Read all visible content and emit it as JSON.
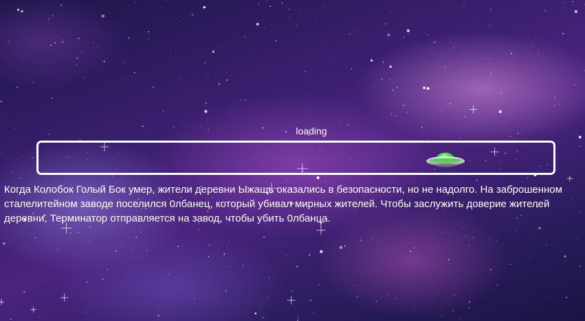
{
  "loading": {
    "label": "loading",
    "progress": 0.79
  },
  "story": {
    "text": "Когда Колобок Голый Бок умер, жители деревни Ыжащь оказались в безопасности, но не надолго. На заброшенном сталелитейном заводе поселился 0лбанец, который убивал мирных жителей. Чтобы заслужить доверие жителей деревни, Терминатор отправляется на завод, чтобы убить 0лбанца."
  },
  "icons": {
    "progress_indicator": "ufo-icon"
  },
  "colors": {
    "bar_border": "#ffffff",
    "text": "#ffffff",
    "ufo_dome": "#35d23a",
    "ufo_saucer": "#c9c9c9"
  }
}
